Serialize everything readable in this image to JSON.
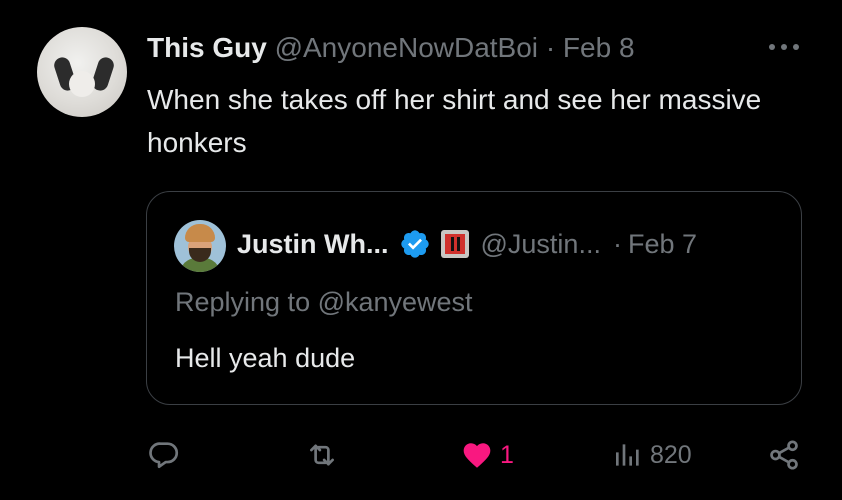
{
  "tweet": {
    "display_name": "This Guy",
    "handle": "@AnyoneNowDatBoi",
    "separator": "·",
    "date": "Feb 8",
    "text": "When she takes off her shirt and see her massive honkers",
    "avatar_icon": "cat-avatar"
  },
  "quote": {
    "display_name": "Justin Wh...",
    "handle": "@Justin...",
    "separator": "·",
    "date": "Feb 7",
    "replying_to": "Replying to @kanyewest",
    "text": "Hell yeah dude",
    "verified_icon": "verified-badge-icon",
    "verified_color": "#1d9bf0",
    "affiliate_icon": "affiliate-badge-icon"
  },
  "actions": {
    "reply_icon": "reply-icon",
    "retweet_icon": "retweet-icon",
    "like_icon": "heart-icon",
    "like_count": "1",
    "like_color": "#f91880",
    "views_icon": "views-icon",
    "views_count": "820",
    "share_icon": "share-icon"
  },
  "colors": {
    "background": "#000000",
    "primary_text": "#e7e9ea",
    "secondary_text": "#71767b",
    "border": "#3b3f44"
  }
}
